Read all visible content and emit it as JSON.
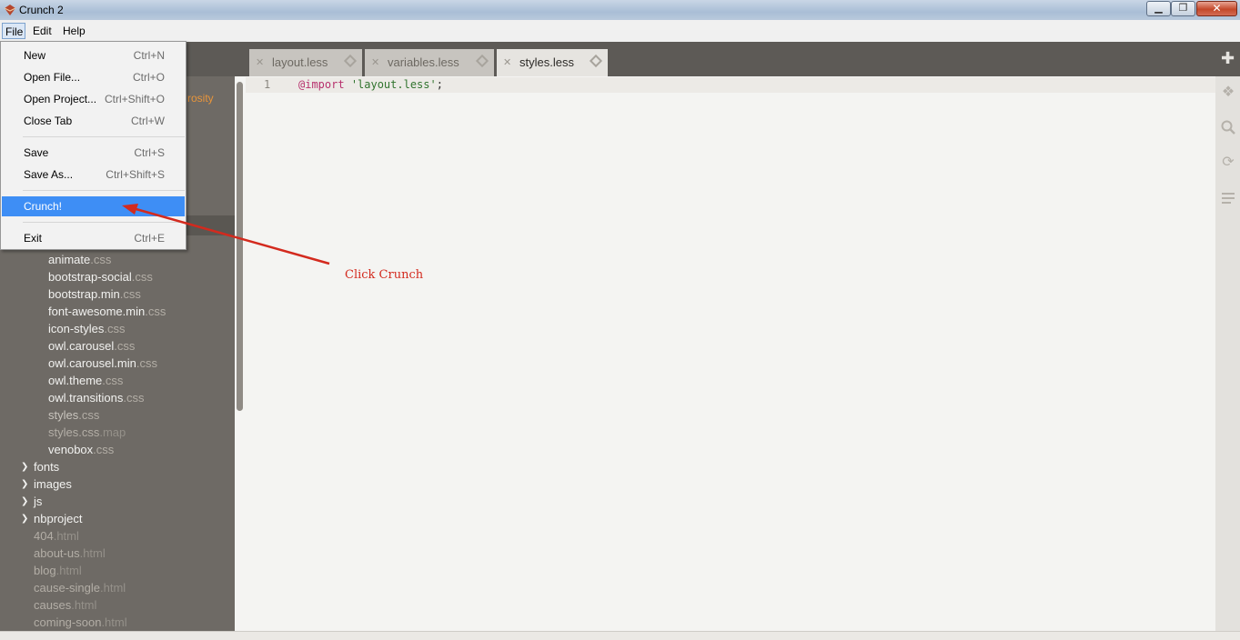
{
  "window": {
    "title": "Crunch 2"
  },
  "menubar": {
    "file": "File",
    "edit": "Edit",
    "help": "Help"
  },
  "file_menu": {
    "items": [
      {
        "label": "New",
        "shortcut": "Ctrl+N"
      },
      {
        "label": "Open File...",
        "shortcut": "Ctrl+O"
      },
      {
        "label": "Open Project...",
        "shortcut": "Ctrl+Shift+O"
      },
      {
        "label": "Close Tab",
        "shortcut": "Ctrl+W"
      },
      {
        "label": "Save",
        "shortcut": "Ctrl+S"
      },
      {
        "label": "Save As...",
        "shortcut": "Ctrl+Shift+S"
      },
      {
        "label": "Crunch!",
        "shortcut": ""
      },
      {
        "label": "Exit",
        "shortcut": "Ctrl+E"
      }
    ]
  },
  "sidebar": {
    "project_fragment": "rosity",
    "css_files": [
      {
        "base": "animate",
        "ext": ".css"
      },
      {
        "base": "bootstrap-social",
        "ext": ".css"
      },
      {
        "base": "bootstrap.min",
        "ext": ".css"
      },
      {
        "base": "font-awesome.min",
        "ext": ".css"
      },
      {
        "base": "icon-styles",
        "ext": ".css"
      },
      {
        "base": "owl.carousel",
        "ext": ".css"
      },
      {
        "base": "owl.carousel.min",
        "ext": ".css"
      },
      {
        "base": "owl.theme",
        "ext": ".css"
      },
      {
        "base": "owl.transitions",
        "ext": ".css"
      },
      {
        "base": "styles",
        "ext": ".css"
      },
      {
        "base": "styles.css",
        "ext": ".map"
      },
      {
        "base": "venobox",
        "ext": ".css"
      }
    ],
    "folders": [
      "fonts",
      "images",
      "js",
      "nbproject"
    ],
    "html_files": [
      {
        "base": "404",
        "ext": ".html"
      },
      {
        "base": "about-us",
        "ext": ".html"
      },
      {
        "base": "blog",
        "ext": ".html"
      },
      {
        "base": "cause-single",
        "ext": ".html"
      },
      {
        "base": "causes",
        "ext": ".html"
      },
      {
        "base": "coming-soon",
        "ext": ".html"
      }
    ]
  },
  "tabs": [
    {
      "label": "layout.less",
      "active": false
    },
    {
      "label": "variables.less",
      "active": false
    },
    {
      "label": "styles.less",
      "active": true
    }
  ],
  "editor": {
    "line_number": "1",
    "code_keyword": "@import",
    "code_string": "'layout.less'",
    "code_punct": ";"
  },
  "annotation": {
    "text": "Click Crunch"
  },
  "colors": {
    "accent": "#3e8ef5",
    "annotation": "#d32a1e",
    "sidebar_bg": "#6e6a65"
  },
  "icons": [
    "app-icon",
    "minimize-icon",
    "maximize-icon",
    "close-icon",
    "plus-icon",
    "diamond-icon",
    "search-icon",
    "refresh-icon",
    "list-icon",
    "chevron-right-icon"
  ]
}
